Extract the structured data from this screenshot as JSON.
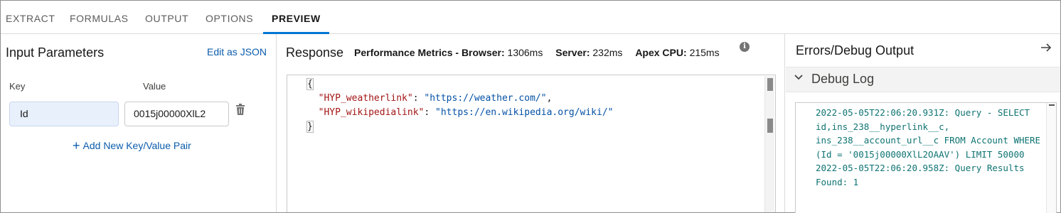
{
  "tabs": [
    "EXTRACT",
    "FORMULAS",
    "OUTPUT",
    "OPTIONS",
    "PREVIEW"
  ],
  "active_tab": "PREVIEW",
  "input_params": {
    "title": "Input Parameters",
    "edit_json": "Edit as JSON",
    "key_label": "Key",
    "value_label": "Value",
    "key_value": "Id",
    "value_value": "0015j00000XlL2",
    "add_pair": "Add New Key/Value Pair"
  },
  "response": {
    "title": "Response",
    "metrics_label": "Performance Metrics - Browser:",
    "browser_ms": "1306ms",
    "server_label": "Server:",
    "server_ms": "232ms",
    "apex_label": "Apex CPU:",
    "apex_ms": "215ms",
    "json_open": "{",
    "key1": "\"HYP_weatherlink\"",
    "val1": "\"https://weather.com/\"",
    "key2": "\"HYP_wikipedialink\"",
    "val2": "\"https://en.wikipedia.org/wiki/\"",
    "json_close": "}"
  },
  "debug": {
    "title": "Errors/Debug Output",
    "section": "Debug Log",
    "log": "2022-05-05T22:06:20.931Z: Query - SELECT id,ins_238__hyperlink__c, ins_238__account_url__c FROM Account WHERE (Id = '0015j00000XlL2OAAV') LIMIT 50000\n2022-05-05T22:06:20.958Z: Query Results Found: 1"
  },
  "colors": {
    "accent": "#0176d3",
    "link": "#0b5cab",
    "log_text": "#0e7372"
  },
  "icons": {
    "info": "info-icon",
    "trash": "trash-icon",
    "expand": "arrow-right-icon",
    "collapse": "chevron-down-icon",
    "add": "plus-icon"
  }
}
